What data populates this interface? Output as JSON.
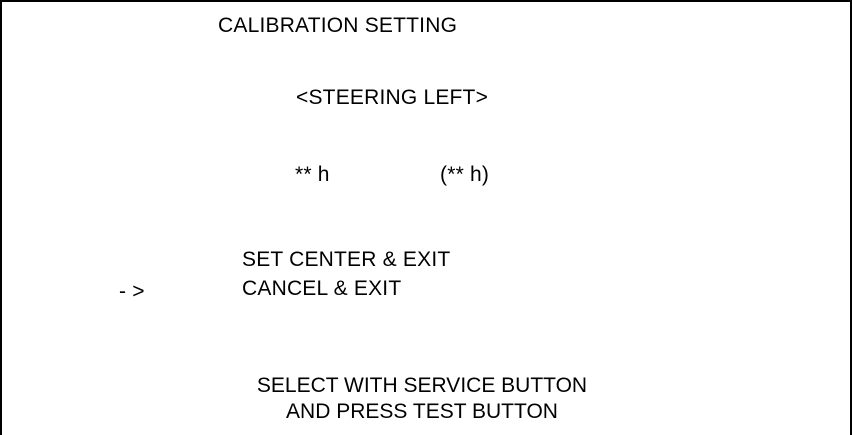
{
  "screen": {
    "title": "CALIBRATION SETTING",
    "subtitle": "<STEERING LEFT>",
    "current_value": "** h",
    "previous_value": "(** h)"
  },
  "menu": {
    "cursor": "- >",
    "items": [
      {
        "label": "SET CENTER & EXIT"
      },
      {
        "label": "CANCEL & EXIT"
      }
    ],
    "selected_index": 1
  },
  "footer": {
    "line1": "SELECT WITH SERVICE BUTTON",
    "line2": "AND PRESS TEST BUTTON"
  },
  "colors": {
    "background": "#ffffff",
    "text": "#000000"
  }
}
